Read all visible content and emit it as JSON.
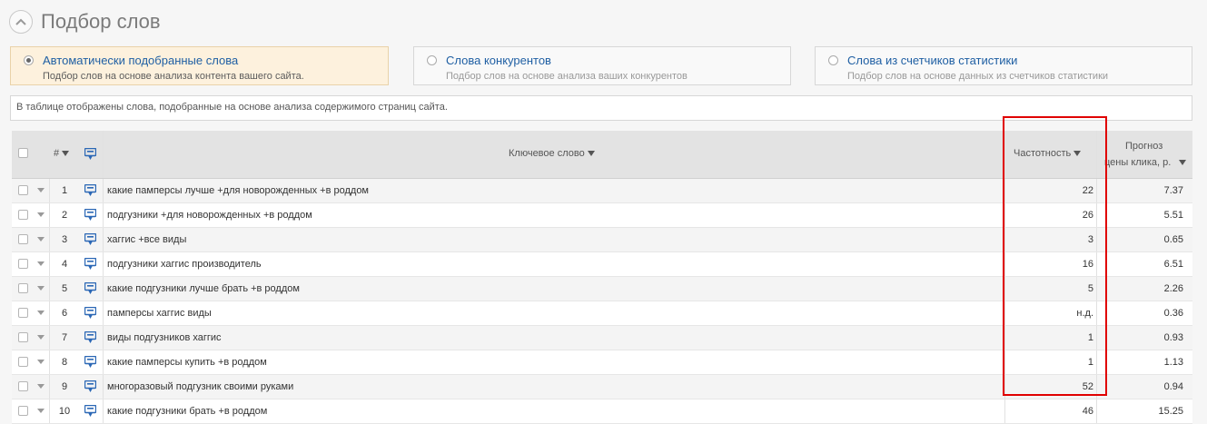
{
  "header": {
    "title": "Подбор слов"
  },
  "modes": [
    {
      "title": "Автоматически подобранные слова",
      "subtitle": "Подбор слов на основе анализа контента вашего сайта.",
      "selected": true
    },
    {
      "title": "Слова конкурентов",
      "subtitle": "Подбор слов на основе анализа ваших конкурентов",
      "selected": false
    },
    {
      "title": "Слова из счетчиков статистики",
      "subtitle": "Подбор слов на основе данных из счетчиков статистики",
      "selected": false
    }
  ],
  "info": "В таблице отображены слова, подобранные на основе анализа содержимого страниц сайта.",
  "table": {
    "columns": {
      "num": "#",
      "keyword": "Ключевое слово",
      "frequency": "Частотность",
      "forecast_line1": "Прогноз",
      "forecast_line2": "цены клика, р."
    },
    "rows": [
      {
        "n": "1",
        "keyword": "какие памперсы лучше +для новорожденных +в роддом",
        "freq": "22",
        "price": "7.37"
      },
      {
        "n": "2",
        "keyword": "подгузники +для новорожденных +в роддом",
        "freq": "26",
        "price": "5.51"
      },
      {
        "n": "3",
        "keyword": "хаггис +все виды",
        "freq": "3",
        "price": "0.65"
      },
      {
        "n": "4",
        "keyword": "подгузники хаггис производитель",
        "freq": "16",
        "price": "6.51"
      },
      {
        "n": "5",
        "keyword": "какие подгузники лучше брать +в роддом",
        "freq": "5",
        "price": "2.26"
      },
      {
        "n": "6",
        "keyword": "памперсы хаггис виды",
        "freq": "н.д.",
        "price": "0.36"
      },
      {
        "n": "7",
        "keyword": "виды подгузников хаггис",
        "freq": "1",
        "price": "0.93"
      },
      {
        "n": "8",
        "keyword": "какие памперсы купить +в роддом",
        "freq": "1",
        "price": "1.13"
      },
      {
        "n": "9",
        "keyword": "многоразовый подгузник своими руками",
        "freq": "52",
        "price": "0.94"
      },
      {
        "n": "10",
        "keyword": "какие подгузники брать +в роддом",
        "freq": "46",
        "price": "15.25"
      }
    ]
  },
  "colors": {
    "accent": "#1f5fa3",
    "highlight_border": "#e00000",
    "active_tab": "#fdf1dd",
    "icon_blue": "#2a67b5"
  }
}
